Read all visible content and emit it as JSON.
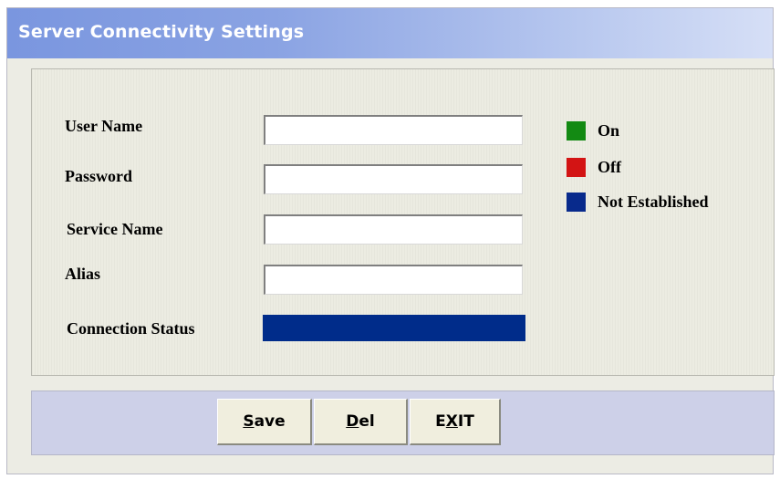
{
  "window": {
    "title": "Server Connectivity Settings"
  },
  "form": {
    "user_name": {
      "label": "User Name",
      "value": ""
    },
    "password": {
      "label": "Password",
      "value": ""
    },
    "service_name": {
      "label": "Service Name",
      "value": ""
    },
    "alias": {
      "label": "Alias",
      "value": ""
    },
    "connection_status": {
      "label": "Connection Status",
      "state": "Not Established",
      "color": "#002c8a"
    }
  },
  "legend": [
    {
      "label": "On",
      "color": "#138a13"
    },
    {
      "label": "Off",
      "color": "#d31414"
    },
    {
      "label": "Not Established",
      "color": "#082a8c"
    }
  ],
  "buttons": {
    "save": {
      "mnemonic": "S",
      "rest": "ave"
    },
    "del": {
      "mnemonic": "D",
      "rest": "el"
    },
    "exit": {
      "pre": "E",
      "mnemonic": "X",
      "rest": "IT"
    }
  }
}
